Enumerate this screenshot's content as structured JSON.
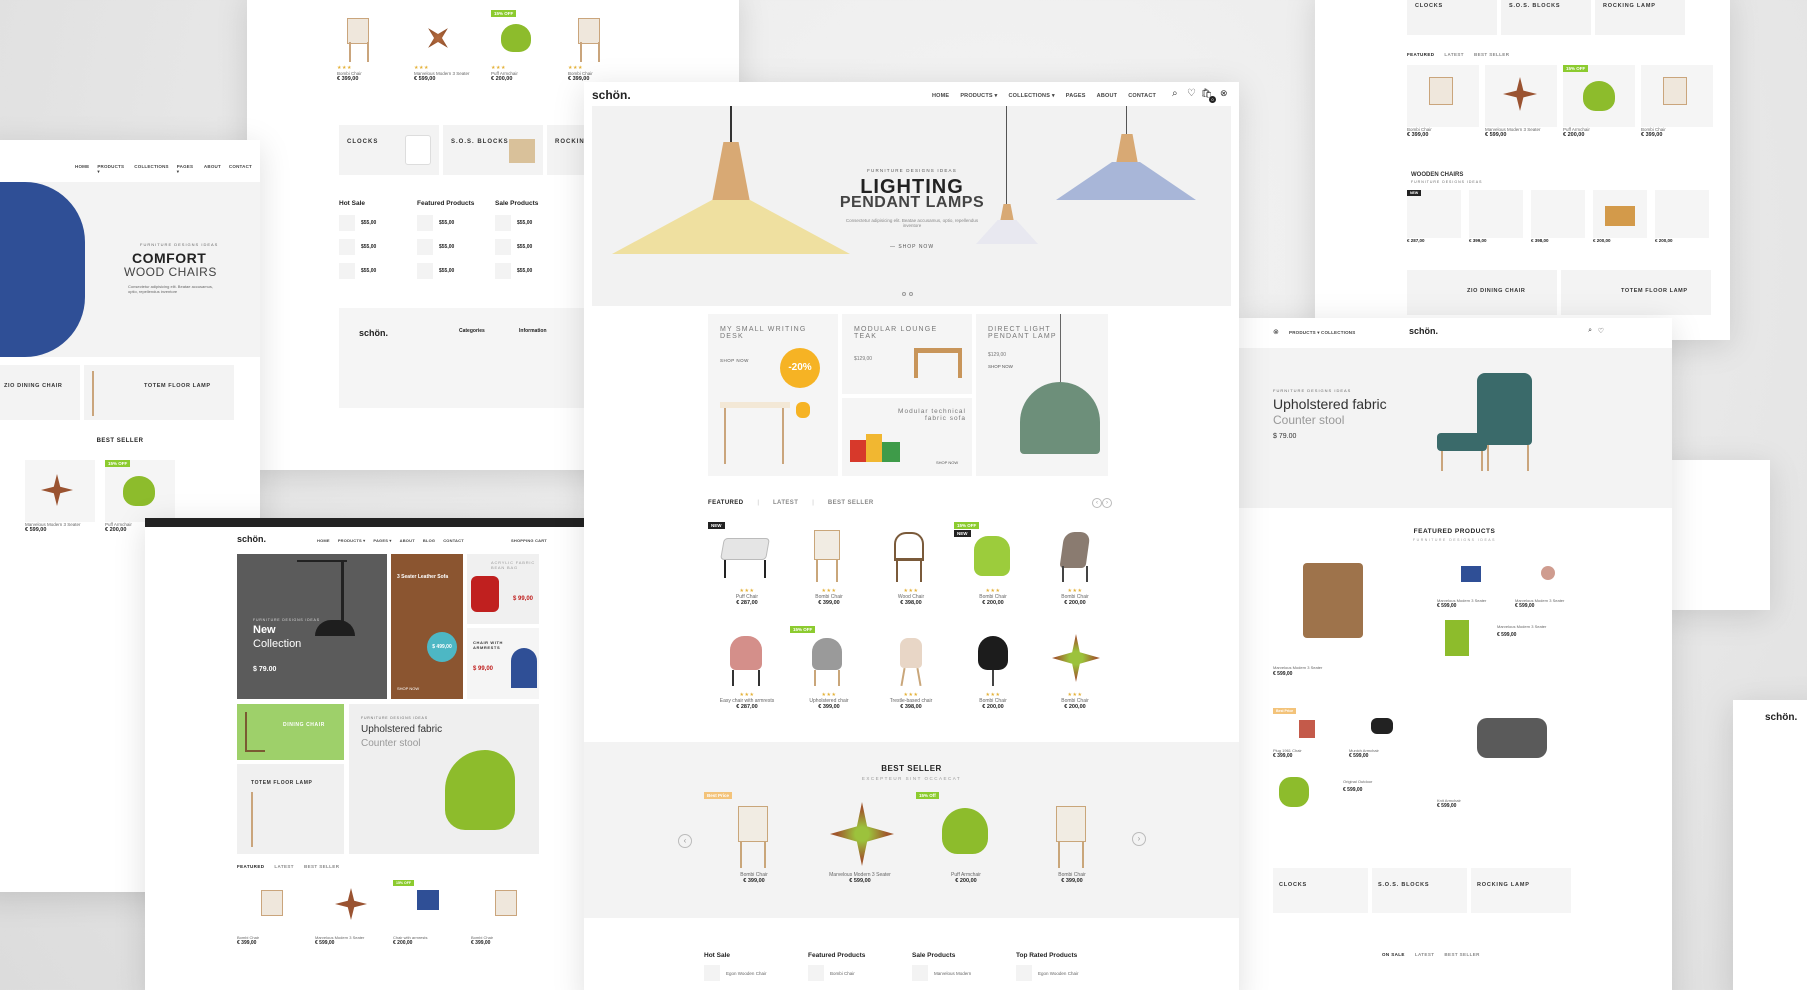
{
  "brand": "schön.",
  "center": {
    "nav": [
      "HOME",
      "PRODUCTS ▾",
      "COLLECTIONS ▾",
      "PAGES",
      "ABOUT",
      "CONTACT"
    ],
    "cart_count": "0",
    "hero": {
      "kicker": "FURNITURE DESIGNS IDEAS",
      "title": "LIGHTING",
      "subtitle": "PENDANT LAMPS",
      "desc": "Consectetur adipisicing elit. Beatae accusamus, optio, repellendus inventore",
      "cta": "SHOP NOW"
    },
    "tiles": [
      {
        "title": "MY SMALL WRITING DESK",
        "cta": "SHOP NOW",
        "discount": "-20%"
      },
      {
        "title": "MODULAR LOUNGE TEAK",
        "price": "$129,00"
      },
      {
        "title": "Modular technical fabric sofa",
        "cta": "SHOP NOW"
      },
      {
        "title": "DIRECT LIGHT PENDANT LAMP",
        "price": "$129,00",
        "cta": "SHOP NOW"
      }
    ],
    "tabs": [
      "FEATURED",
      "LATEST",
      "BEST SELLER"
    ],
    "products_row1": [
      {
        "name": "Puff Chair",
        "price": "€ 287,00",
        "badge": "NEW"
      },
      {
        "name": "Bombi Chair",
        "price": "€ 399,00"
      },
      {
        "name": "Wood Chair",
        "price": "€ 398,00"
      },
      {
        "name": "Bombi Chair",
        "price": "€ 200,00",
        "badge": "15% OFF",
        "badge2": "NEW"
      },
      {
        "name": "Bombi Chair",
        "price": "€ 200,00"
      }
    ],
    "products_row2": [
      {
        "name": "Easy chair with armrests",
        "price": "€ 287,00"
      },
      {
        "name": "Upholstered chair",
        "price": "€ 399,00",
        "badge": "15% OFF"
      },
      {
        "name": "Trestle-based chair",
        "price": "€ 398,00"
      },
      {
        "name": "Bombi Chair",
        "price": "€ 200,00"
      },
      {
        "name": "Bombi Chair",
        "price": "€ 200,00"
      }
    ],
    "best_seller": {
      "title": "BEST SELLER",
      "subtitle": "EXCEPTEUR SINT OCCAECAT",
      "items": [
        {
          "name": "Bombi Chair",
          "price": "€ 399,00",
          "badge": "Best Price"
        },
        {
          "name": "Marvelous Modern 3 Seater",
          "price": "€ 599,00"
        },
        {
          "name": "Puff Armchair",
          "price": "€ 200,00",
          "badge": "15% Off"
        },
        {
          "name": "Bombi Chair",
          "price": "€ 399,00"
        }
      ]
    },
    "footer_lists": [
      "Hot Sale",
      "Featured Products",
      "Sale Products",
      "Top Rated Products"
    ],
    "footer_items": [
      "Egon Wooden Chair",
      "Bombi Chair",
      "Marvelous Modern",
      "Egon Wooden Chair"
    ]
  },
  "left": {
    "nav": [
      "HOME",
      "PRODUCTS ▾",
      "COLLECTIONS",
      "PAGES ▾",
      "ABOUT",
      "CONTACT"
    ],
    "hero": {
      "kicker": "FURNITURE DESIGNS IDEAS",
      "title": "COMFORT",
      "subtitle": "WOOD CHAIRS",
      "desc": "Consectetur adipisicing elit. Beatae accusamus, optio, repellendus inventore"
    },
    "tiles": [
      "ZIO DINING CHAIR",
      "TOTEM FLOOR LAMP"
    ],
    "best": "BEST SELLER",
    "products": [
      {
        "name": "Marvelous Modern 3 Seater",
        "price": "€ 599,00"
      },
      {
        "name": "Puff Armchair",
        "price": "€ 200,00",
        "badge": "15% OFF"
      }
    ]
  },
  "topleft": {
    "products": [
      {
        "name": "Bombi Chair",
        "price": "€ 399,00"
      },
      {
        "name": "Marvelous Modern 3 Seater",
        "price": "€ 599,00"
      },
      {
        "name": "Puff Armchair",
        "price": "€ 200,00",
        "badge": "15% OFF"
      },
      {
        "name": "Bombi Chair",
        "price": "€ 399,00"
      }
    ],
    "tiles": [
      "CLOCKS",
      "S.O.S. BLOCKS",
      "ROCKING"
    ],
    "lists": [
      "Hot Sale",
      "Featured Products",
      "Sale Products"
    ],
    "footer_cols": [
      "Categories",
      "Information"
    ]
  },
  "bottomleft": {
    "nav": [
      "HOME",
      "PRODUCTS ▾",
      "PAGES ▾",
      "ABOUT",
      "BLOG",
      "CONTACT"
    ],
    "cart": "SHOPPING CART",
    "tiles": [
      {
        "kicker": "FURNITURE DESIGNS IDEAS",
        "title": "New",
        "subtitle": "Collection",
        "price": "$ 79.00"
      },
      {
        "title": "3 Seater Leather Sofa",
        "price": "$ 499,00",
        "cta": "SHOP NOW"
      },
      {
        "title": "ACRYLIC FABRIC BEAN BAG",
        "price": "$ 99,00",
        "cta": "SHOP NOW"
      },
      {
        "title": "CHAIR WITH ARMRESTS",
        "price": "$ 99,00",
        "cta": "SHOP UP"
      },
      {
        "title": "DINING CHAIR",
        "cta": "SHOP NOW"
      },
      {
        "kicker": "FURNITURE DESIGNS IDEAS",
        "title": "Upholstered fabric",
        "subtitle": "Counter stool"
      },
      {
        "title": "TOTEM FLOOR LAMP"
      }
    ],
    "tabs": [
      "FEATURED",
      "LATEST",
      "BEST SELLER"
    ],
    "products": [
      {
        "name": "Bombi Chair",
        "price": "€ 399,00"
      },
      {
        "name": "Marvelous Modern 3 Seater",
        "price": "€ 599,00"
      },
      {
        "name": "Chair with armrests",
        "price": "€ 200,00",
        "badge": "15% OFF"
      },
      {
        "name": "Bombi Chair",
        "price": "€ 399,00"
      }
    ]
  },
  "right": {
    "nav": [
      "PRODUCTS ▾",
      "COLLECTIONS"
    ],
    "hero": {
      "kicker": "FURNITURE DESIGNS IDEAS",
      "title": "Upholstered fabric",
      "subtitle": "Counter stool",
      "price": "$ 79.00"
    },
    "featured": {
      "title": "FEATURED PRODUCTS",
      "subtitle": "FURNITURE DESIGNS IDEAS"
    },
    "products": [
      {
        "name": "Marvelous Modern 3 Seater",
        "price": "€ 599,00"
      },
      {
        "name": "Marvelous Modern 3 Seater",
        "price": "€ 599,00"
      },
      {
        "name": "Marvelous Modern 3 Seater",
        "price": "€ 599,00"
      },
      {
        "name": "Marvelous Modern 3 Seater",
        "price": "€ 599,00"
      },
      {
        "name": "Plug 1961 Chair",
        "price": "€ 399,00",
        "badge": "Best Price"
      },
      {
        "name": "Munich Armchair",
        "price": "€ 599,00"
      },
      {
        "name": "Original Outdoor",
        "price": "€ 599,00"
      },
      {
        "name": "Knit Armchair",
        "price": "€ 599,00"
      }
    ],
    "tiles": [
      "CLOCKS",
      "S.O.S. BLOCKS",
      "ROCKING LAMP"
    ],
    "tabs": [
      "ON SALE",
      "LATEST",
      "BEST SELLER"
    ]
  },
  "topright": {
    "tiles": [
      "CLOCKS",
      "S.O.S. BLOCKS",
      "ROCKING LAMP"
    ],
    "tabs": [
      "FEATURED",
      "LATEST",
      "BEST SELLER"
    ],
    "products": [
      {
        "name": "Bombi Chair",
        "price": "€ 399,00"
      },
      {
        "name": "Marvelous Modern 3 Seater",
        "price": "€ 599,00"
      },
      {
        "name": "Puff Armchair",
        "price": "€ 200,00",
        "badge": "15% OFF"
      },
      {
        "name": "Bombi Chair",
        "price": "€ 399,00"
      }
    ],
    "wooden": {
      "title": "WOODEN CHAIRS",
      "subtitle": "FURNITURE DESIGNS IDEAS"
    },
    "wooden_prices": [
      "€ 287,00",
      "€ 399,00",
      "€ 398,00",
      "€ 200,00",
      "€ 200,00"
    ],
    "tiles2": [
      "ZIO DINING CHAIR",
      "TOTEM FLOOR LAMP"
    ]
  },
  "farright": {
    "logo": "schön."
  }
}
